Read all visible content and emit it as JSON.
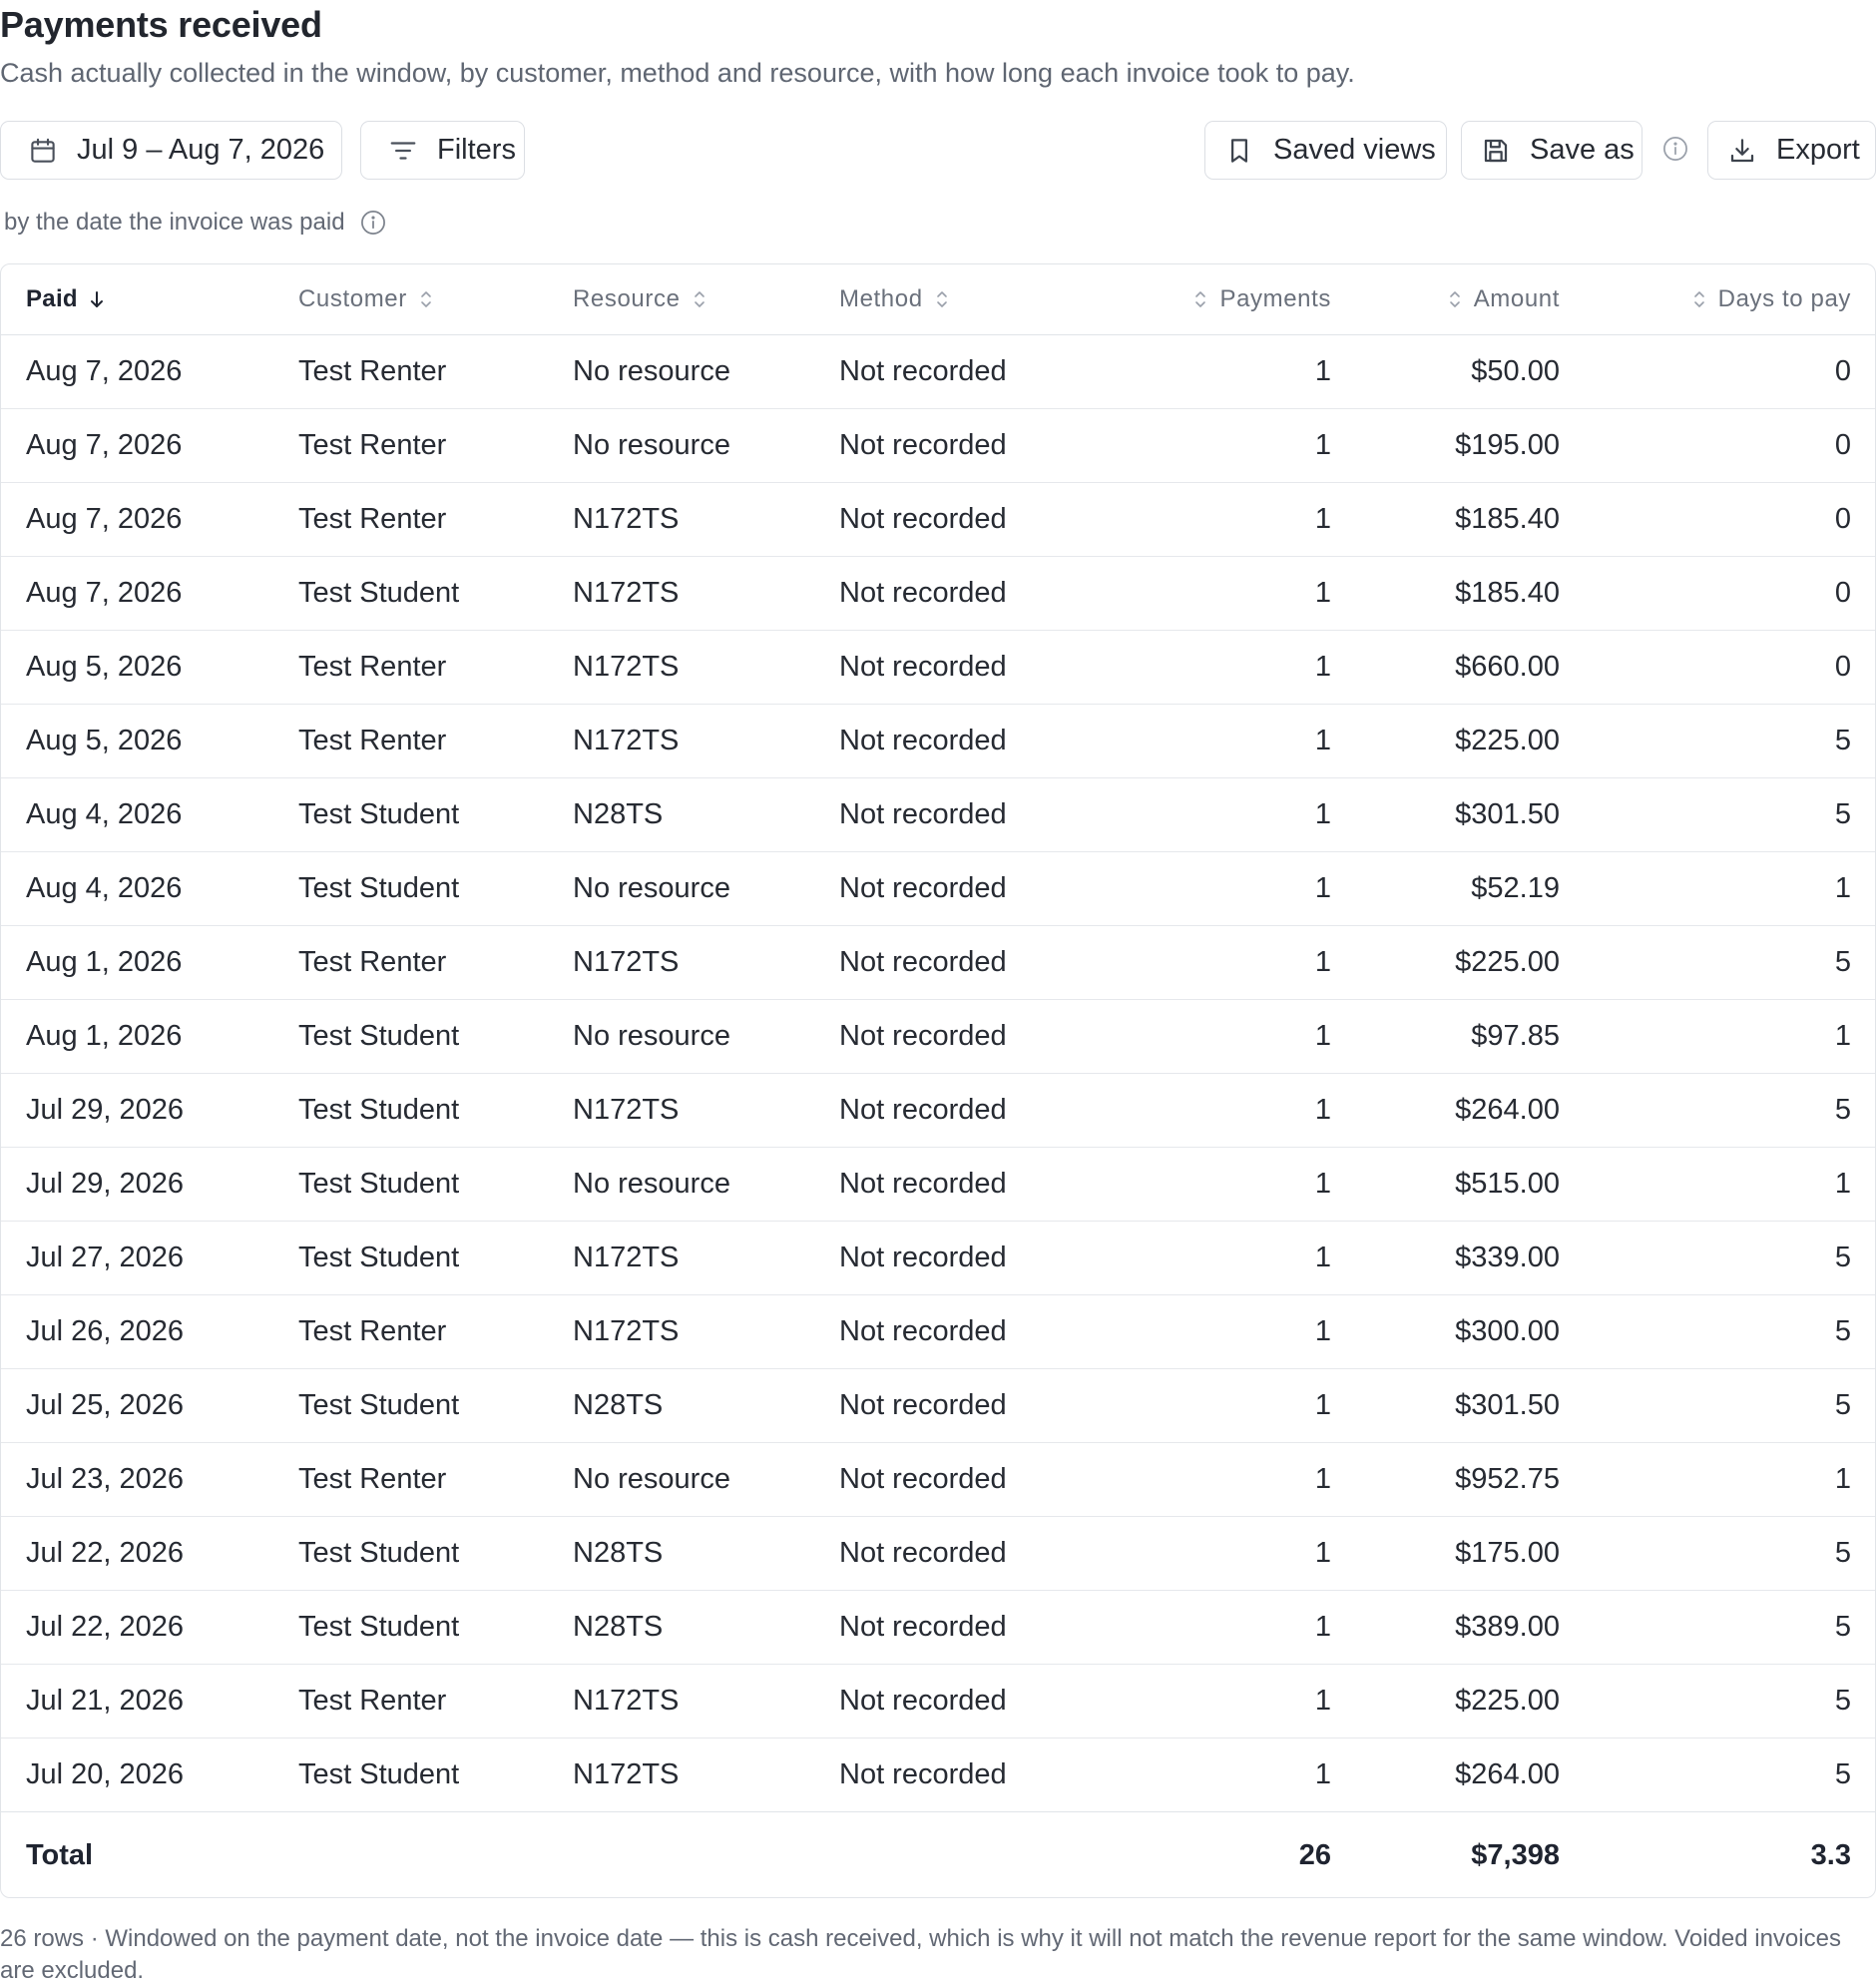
{
  "page": {
    "title": "Payments received",
    "subtitle": "Cash actually collected in the window, by customer, method and resource, with how long each invoice took to pay."
  },
  "toolbar": {
    "date_range": "Jul 9 – Aug 7, 2026",
    "filters_label": "Filters",
    "saved_views_label": "Saved views",
    "save_as_label": "Save as",
    "export_label": "Export",
    "icons": {
      "date": "calendar-icon",
      "filters": "filter-lines-icon",
      "saved_views": "bookmark-icon",
      "save_as": "floppy-disk-icon",
      "info": "info-icon",
      "export": "download-icon"
    }
  },
  "note": {
    "text": "by the date the invoice was paid"
  },
  "table": {
    "columns": {
      "paid": "Paid",
      "customer": "Customer",
      "resource": "Resource",
      "method": "Method",
      "payments": "Payments",
      "amount": "Amount",
      "days": "Days to pay"
    },
    "sort": {
      "column": "Paid",
      "direction": "descending"
    },
    "rows": [
      {
        "paid": "Aug 7, 2026",
        "customer": "Test Renter",
        "resource": "No resource",
        "method": "Not recorded",
        "payments": "1",
        "amount": "$50.00",
        "days": "0"
      },
      {
        "paid": "Aug 7, 2026",
        "customer": "Test Renter",
        "resource": "No resource",
        "method": "Not recorded",
        "payments": "1",
        "amount": "$195.00",
        "days": "0"
      },
      {
        "paid": "Aug 7, 2026",
        "customer": "Test Renter",
        "resource": "N172TS",
        "method": "Not recorded",
        "payments": "1",
        "amount": "$185.40",
        "days": "0"
      },
      {
        "paid": "Aug 7, 2026",
        "customer": "Test Student",
        "resource": "N172TS",
        "method": "Not recorded",
        "payments": "1",
        "amount": "$185.40",
        "days": "0"
      },
      {
        "paid": "Aug 5, 2026",
        "customer": "Test Renter",
        "resource": "N172TS",
        "method": "Not recorded",
        "payments": "1",
        "amount": "$660.00",
        "days": "0"
      },
      {
        "paid": "Aug 5, 2026",
        "customer": "Test Renter",
        "resource": "N172TS",
        "method": "Not recorded",
        "payments": "1",
        "amount": "$225.00",
        "days": "5"
      },
      {
        "paid": "Aug 4, 2026",
        "customer": "Test Student",
        "resource": "N28TS",
        "method": "Not recorded",
        "payments": "1",
        "amount": "$301.50",
        "days": "5"
      },
      {
        "paid": "Aug 4, 2026",
        "customer": "Test Student",
        "resource": "No resource",
        "method": "Not recorded",
        "payments": "1",
        "amount": "$52.19",
        "days": "1"
      },
      {
        "paid": "Aug 1, 2026",
        "customer": "Test Renter",
        "resource": "N172TS",
        "method": "Not recorded",
        "payments": "1",
        "amount": "$225.00",
        "days": "5"
      },
      {
        "paid": "Aug 1, 2026",
        "customer": "Test Student",
        "resource": "No resource",
        "method": "Not recorded",
        "payments": "1",
        "amount": "$97.85",
        "days": "1"
      },
      {
        "paid": "Jul 29, 2026",
        "customer": "Test Student",
        "resource": "N172TS",
        "method": "Not recorded",
        "payments": "1",
        "amount": "$264.00",
        "days": "5"
      },
      {
        "paid": "Jul 29, 2026",
        "customer": "Test Student",
        "resource": "No resource",
        "method": "Not recorded",
        "payments": "1",
        "amount": "$515.00",
        "days": "1"
      },
      {
        "paid": "Jul 27, 2026",
        "customer": "Test Student",
        "resource": "N172TS",
        "method": "Not recorded",
        "payments": "1",
        "amount": "$339.00",
        "days": "5"
      },
      {
        "paid": "Jul 26, 2026",
        "customer": "Test Renter",
        "resource": "N172TS",
        "method": "Not recorded",
        "payments": "1",
        "amount": "$300.00",
        "days": "5"
      },
      {
        "paid": "Jul 25, 2026",
        "customer": "Test Student",
        "resource": "N28TS",
        "method": "Not recorded",
        "payments": "1",
        "amount": "$301.50",
        "days": "5"
      },
      {
        "paid": "Jul 23, 2026",
        "customer": "Test Renter",
        "resource": "No resource",
        "method": "Not recorded",
        "payments": "1",
        "amount": "$952.75",
        "days": "1"
      },
      {
        "paid": "Jul 22, 2026",
        "customer": "Test Student",
        "resource": "N28TS",
        "method": "Not recorded",
        "payments": "1",
        "amount": "$175.00",
        "days": "5"
      },
      {
        "paid": "Jul 22, 2026",
        "customer": "Test Student",
        "resource": "N28TS",
        "method": "Not recorded",
        "payments": "1",
        "amount": "$389.00",
        "days": "5"
      },
      {
        "paid": "Jul 21, 2026",
        "customer": "Test Renter",
        "resource": "N172TS",
        "method": "Not recorded",
        "payments": "1",
        "amount": "$225.00",
        "days": "5"
      },
      {
        "paid": "Jul 20, 2026",
        "customer": "Test Student",
        "resource": "N172TS",
        "method": "Not recorded",
        "payments": "1",
        "amount": "$264.00",
        "days": "5"
      }
    ],
    "total": {
      "label": "Total",
      "payments": "26",
      "amount": "$7,398",
      "days": "3.3"
    }
  },
  "footer": {
    "text": "26 rows · Windowed on the payment date, not the invoice date — this is cash received, which is why it will not match the revenue report for the same window. Voided invoices are excluded."
  }
}
